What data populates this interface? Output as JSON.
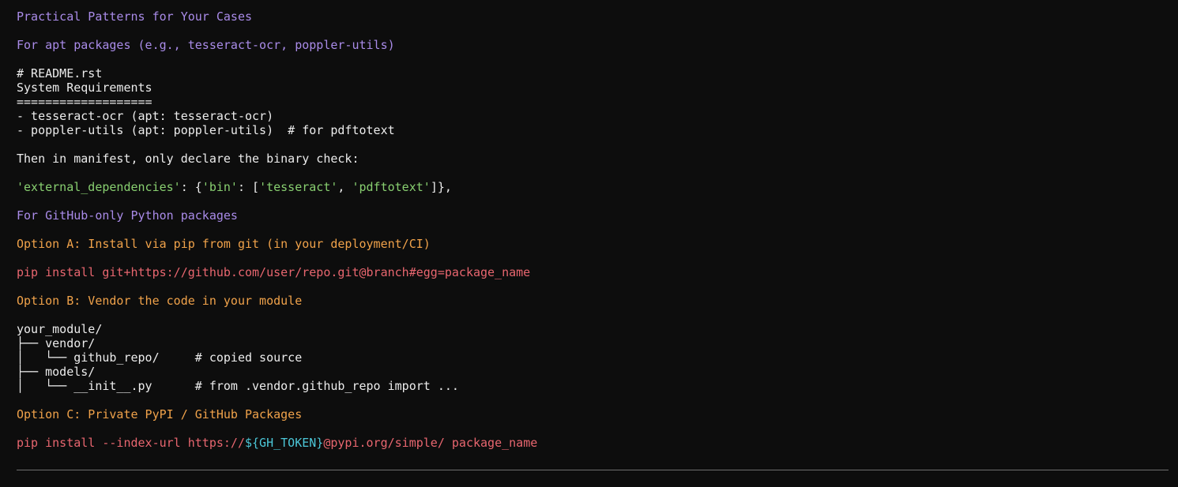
{
  "heading": "Practical Patterns for Your Cases",
  "apt_section": {
    "title": "For apt packages (e.g., tesseract-ocr, poppler-utils)",
    "readme_lines": [
      "# README.rst",
      "System Requirements",
      "===================",
      "- tesseract-ocr (apt: tesseract-ocr)",
      "- poppler-utils (apt: poppler-utils)  # for pdftotext"
    ],
    "manifest_note": "Then in manifest, only declare the binary check:",
    "manifest_code": {
      "key": "'external_dependencies'",
      "colon_open": ": {",
      "bin_key": "'bin'",
      "colon_list": ": [",
      "bin1": "'tesseract'",
      "comma": ", ",
      "bin2": "'pdftotext'",
      "close": "]},"
    }
  },
  "github_section": {
    "title": "For GitHub-only Python packages",
    "option_a": {
      "title": "Option A: Install via pip from git (in your deployment/CI)",
      "command": "pip install git+https://github.com/user/repo.git@branch#egg=package_name"
    },
    "option_b": {
      "title": "Option B: Vendor the code in your module",
      "tree": [
        "your_module/",
        "├── vendor/",
        "│   └── github_repo/     # copied source",
        "├── models/",
        "│   └── __init__.py      # from .vendor.github_repo import ..."
      ]
    },
    "option_c": {
      "title": "Option C: Private PyPI / GitHub Packages",
      "command_prefix": "pip install --index-url https://",
      "command_var": "${GH_TOKEN}",
      "command_suffix": "@pypi.org/simple/ package_name"
    }
  },
  "colors": {
    "background": "#0d0d0d",
    "heading": "#a98be8",
    "option": "#f0a24a",
    "command": "#e8666f",
    "string": "#88cf70",
    "variable": "#4cc7d8",
    "text": "#ececec"
  }
}
